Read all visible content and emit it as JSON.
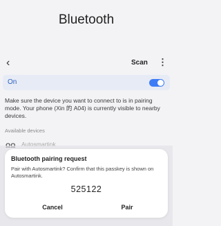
{
  "header": {
    "title": "Bluetooth",
    "back_icon": "‹",
    "scan_label": "Scan",
    "more_icon": "⋮"
  },
  "bluetooth_toggle": {
    "label": "On",
    "state": true,
    "accent_color": "#3e7bf6"
  },
  "info_text": "Make sure the device you want to connect to is in pairing mode. Your phone (Xin 的 A04) is currently visible to nearby devices.",
  "available_devices": {
    "section_label": "Available devices",
    "items": [
      {
        "icon": "headset-icon",
        "icon_glyph": "ΩΩ",
        "name": "Autosmartink"
      }
    ]
  },
  "pairing_dialog": {
    "title": "Bluetooth pairing request",
    "message": "Pair with Autosmartink? Confirm that this passkey is shown on Autosmartink.",
    "passkey": "525122",
    "cancel_label": "Cancel",
    "pair_label": "Pair"
  }
}
